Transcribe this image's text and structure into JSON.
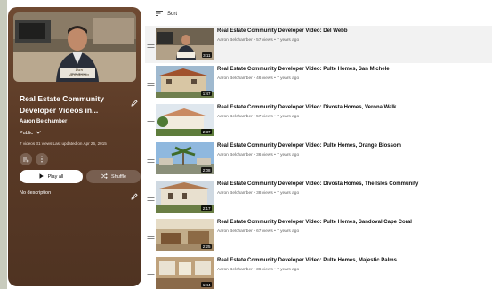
{
  "playlist": {
    "title": "Real Estate Community Developer Videos in...",
    "owner": "Aaron Belchamber",
    "privacy": "Public",
    "stats": "7 videos  31 views  Last updated on Apr 26, 2015",
    "play_all_label": "Play all",
    "shuffle_label": "Shuffle",
    "description": "No description",
    "hero_caption_script": "Dan Armstrong",
    "hero_caption_small": "Pulte Homes"
  },
  "sort": {
    "label": "Sort"
  },
  "videos": [
    {
      "title": "Real Estate Community Developer Video: Del Webb",
      "meta": "Aaron Belchamber • 57 views • 7 years ago",
      "duration": "3:11"
    },
    {
      "title": "Real Estate Community Developer Video: Pulte Homes, San Michele",
      "meta": "Aaron Belchamber • 46 views • 7 years ago",
      "duration": "1:47"
    },
    {
      "title": "Real Estate Community Developer Video: Divosta Homes, Verona Walk",
      "meta": "Aaron Belchamber • 57 views • 7 years ago",
      "duration": "2:37"
    },
    {
      "title": "Real Estate Community Developer Video: Pulte Homes, Orange Blossom",
      "meta": "Aaron Belchamber • 36 views • 7 years ago",
      "duration": "2:08"
    },
    {
      "title": "Real Estate Community Developer Video: Divosta Homes, The Isles Community",
      "meta": "Aaron Belchamber • 38 views • 7 years ago",
      "duration": "2:17"
    },
    {
      "title": "Real Estate Community Developer Video: Pulte Homes, Sandoval Cape Coral",
      "meta": "Aaron Belchamber • 67 views • 7 years ago",
      "duration": "2:25"
    },
    {
      "title": "Real Estate Community Developer Video: Pulte Homes, Majestic Palms",
      "meta": "Aaron Belchamber • 36 views • 7 years ago",
      "duration": "1:44"
    }
  ],
  "colors": {
    "panel_brown": "#5a3a26",
    "active_row": "#f2f2f2",
    "text_primary": "#0f0f0f",
    "text_secondary": "#606060"
  },
  "icons": {
    "edit": "pencil-icon",
    "privacy_dropdown": "chevron-down-icon",
    "sort": "sort-lines-icon",
    "drag": "drag-handle-icon",
    "play": "play-icon",
    "shuffle": "shuffle-icon",
    "add": "add-to-queue-icon",
    "more": "more-vert-icon"
  }
}
